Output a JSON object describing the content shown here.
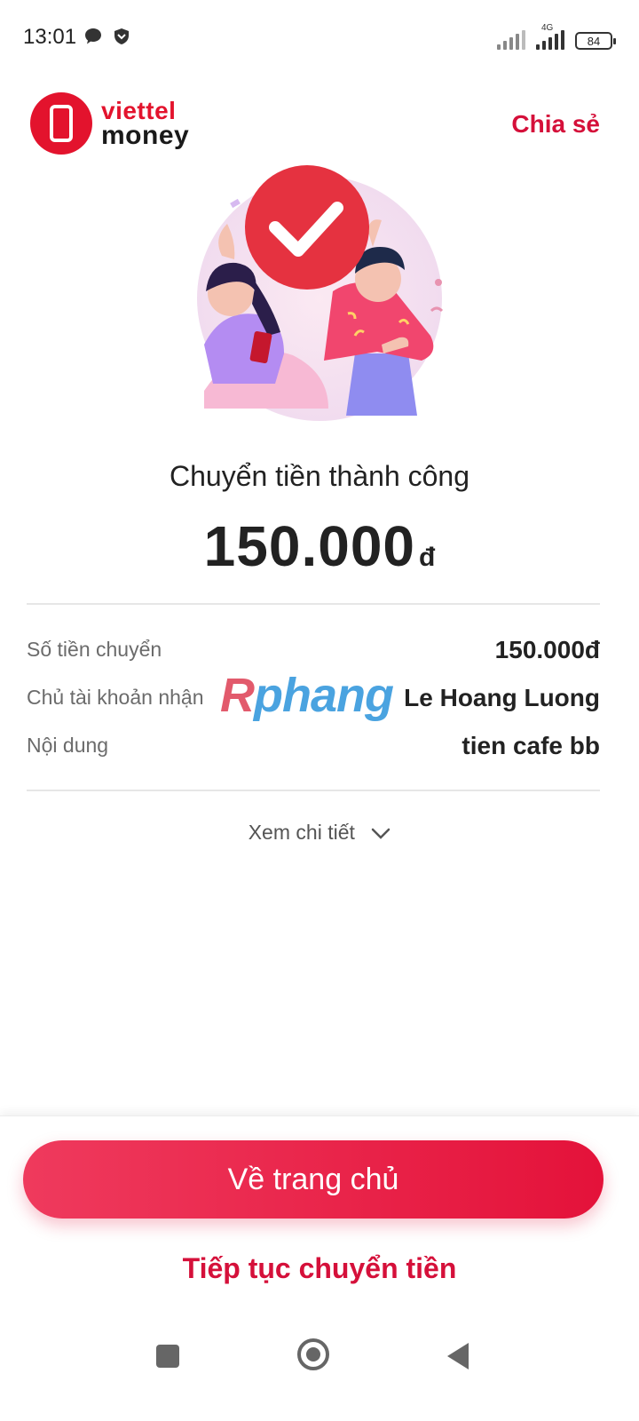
{
  "status_bar": {
    "time": "13:01",
    "network_type": "4G",
    "battery": "84",
    "icons": [
      "chat-bubble-icon",
      "shield-icon",
      "signal-icon",
      "signal-4g-icon",
      "battery-icon"
    ]
  },
  "header": {
    "logo_line1": "viettel",
    "logo_line2": "money",
    "share_label": "Chia sẻ"
  },
  "result": {
    "title": "Chuyển tiền thành công",
    "amount": "150.000",
    "currency": "đ"
  },
  "details": {
    "rows": [
      {
        "label": "Số tiền chuyển",
        "value": "150.000đ"
      },
      {
        "label": "Chủ tài khoản nhận",
        "value": "Le Hoang Luong"
      },
      {
        "label": "Nội dung",
        "value": "tien cafe bb"
      }
    ],
    "toggle_label": "Xem chi tiết"
  },
  "watermark": {
    "first": "R",
    "rest": "phang"
  },
  "actions": {
    "home_label": "Về trang chủ",
    "continue_label": "Tiếp tục chuyển tiền"
  },
  "colors": {
    "brand": "#e3132d",
    "accent": "#d5103a",
    "button_start": "#ef3a5d",
    "button_end": "#e4123a"
  }
}
